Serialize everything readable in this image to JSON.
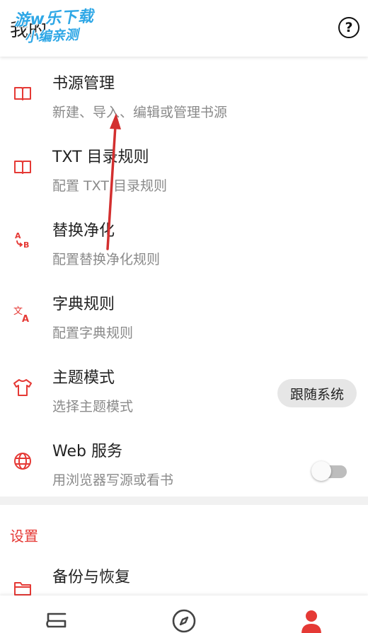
{
  "app_bar": {
    "title": "我的",
    "help_icon": "help-circle-icon"
  },
  "watermark": {
    "line1": "游w乐下载",
    "line2": "小编亲测"
  },
  "items": [
    {
      "title": "书源管理",
      "subtitle": "新建、导入、编辑或管理书源",
      "icon": "book-open-icon"
    },
    {
      "title": "TXT 目录规则",
      "subtitle": "配置 TXT 目录规则",
      "icon": "book-open-icon"
    },
    {
      "title": "替换净化",
      "subtitle": "配置替换净化规则",
      "icon": "replace-ab-icon"
    },
    {
      "title": "字典规则",
      "subtitle": "配置字典规则",
      "icon": "translate-icon"
    },
    {
      "title": "主题模式",
      "subtitle": "选择主题模式",
      "icon": "shirt-icon",
      "value": "跟随系统"
    },
    {
      "title": "Web 服务",
      "subtitle": "用浏览器写源或看书",
      "icon": "globe-icon",
      "toggle_on": false
    }
  ],
  "settings_section": {
    "header": "设置",
    "first_item": "备份与恢复",
    "first_item_icon": "folder-icon"
  },
  "bottom_nav": [
    {
      "icon": "bookshelf-icon"
    },
    {
      "icon": "compass-icon"
    },
    {
      "icon": "person-icon",
      "active": true
    }
  ],
  "colors": {
    "accent": "#e53935",
    "subtitle": "#8a8a8a",
    "watermark": "#2ea7e6"
  }
}
